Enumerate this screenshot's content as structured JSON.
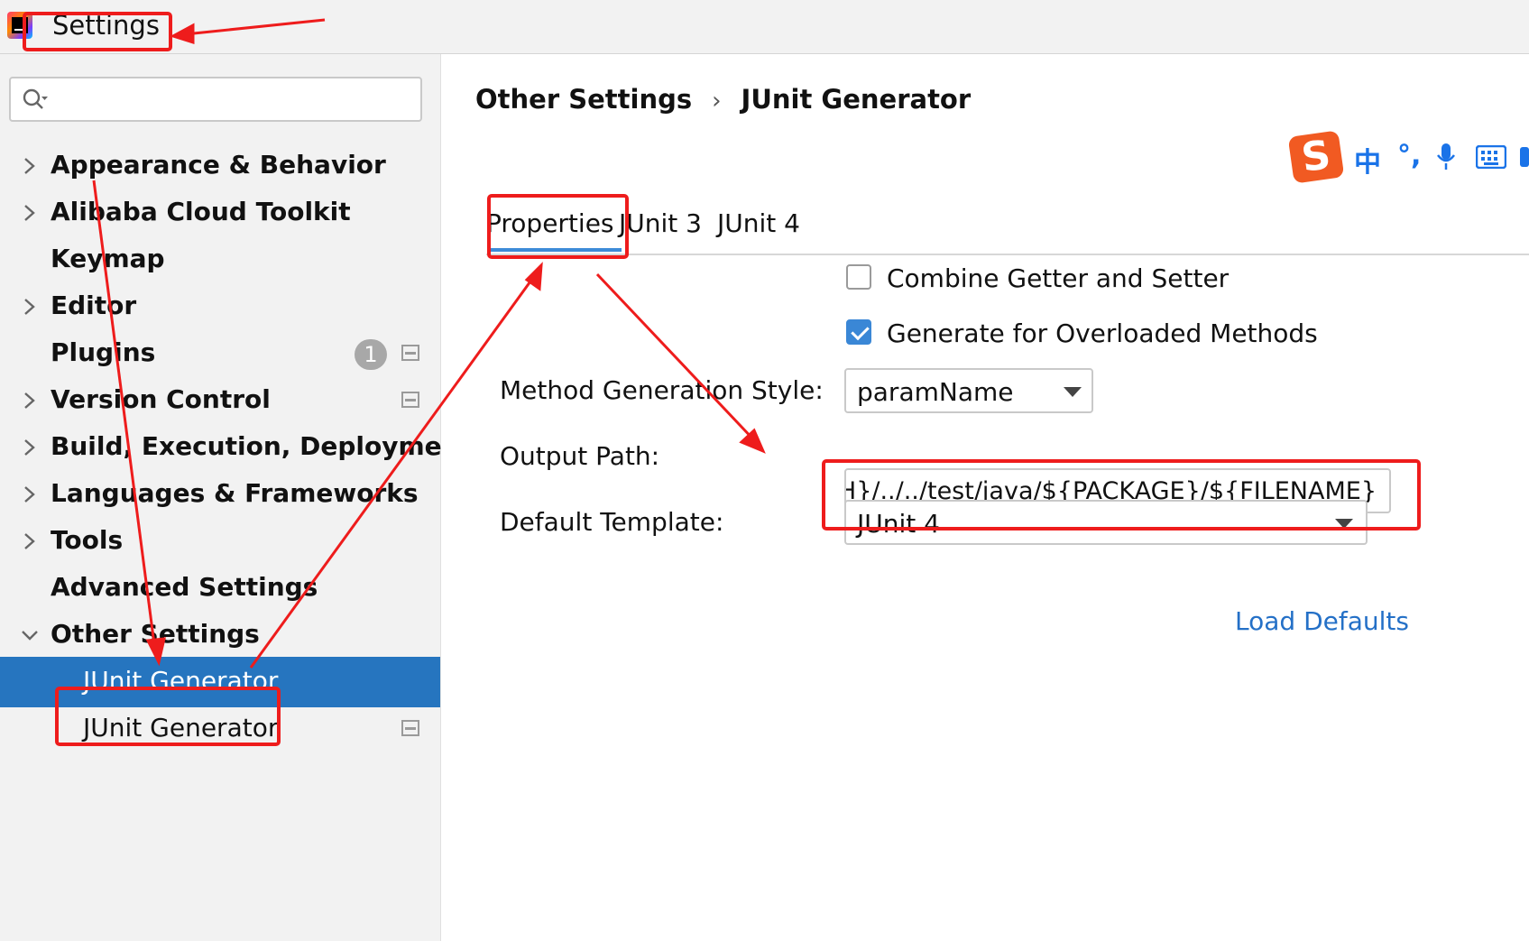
{
  "window": {
    "title": "Settings"
  },
  "search": {
    "placeholder": ""
  },
  "sidebar": {
    "items": [
      {
        "label": "Appearance & Behavior",
        "expandable": true
      },
      {
        "label": "Alibaba Cloud Toolkit",
        "expandable": true
      },
      {
        "label": "Keymap",
        "expandable": false
      },
      {
        "label": "Editor",
        "expandable": true
      },
      {
        "label": "Plugins",
        "expandable": false,
        "badge": "1"
      },
      {
        "label": "Version Control",
        "expandable": true
      },
      {
        "label": "Build, Execution, Deployment",
        "expandable": true
      },
      {
        "label": "Languages & Frameworks",
        "expandable": true
      },
      {
        "label": "Tools",
        "expandable": true
      },
      {
        "label": "Advanced Settings",
        "expandable": false
      },
      {
        "label": "Other Settings",
        "expandable": true,
        "expanded": true
      },
      {
        "label": "JUnit Generator",
        "selected": true
      },
      {
        "label": "JUnit Generator"
      }
    ]
  },
  "breadcrumb": {
    "parent": "Other Settings",
    "separator": "›",
    "current": "JUnit Generator"
  },
  "ime": {
    "logo": "S",
    "lang": "中",
    "punct": "°,",
    "mic_icon": "microphone-icon",
    "keyboard_icon": "keyboard-icon"
  },
  "tabs": [
    {
      "label": "Properties",
      "active": true
    },
    {
      "label": "JUnit 3"
    },
    {
      "label": "JUnit 4"
    }
  ],
  "options": {
    "combine_getter_setter": {
      "label": "Combine Getter and Setter",
      "checked": false
    },
    "generate_overloaded": {
      "label": "Generate for Overloaded Methods",
      "checked": true
    }
  },
  "form": {
    "method_style": {
      "label": "Method Generation Style:",
      "value": "paramName"
    },
    "output_path": {
      "label": "Output Path:",
      "value": "\\TH}/../../test/java/${PACKAGE}/${FILENAME}"
    },
    "default_template": {
      "label": "Default Template:",
      "value": "JUnit 4"
    }
  },
  "load_defaults": "Load Defaults",
  "colors": {
    "selection": "#2675bf",
    "link": "#2470c7",
    "annotation": "#ee1c1c",
    "checkbox": "#3a87d6"
  }
}
